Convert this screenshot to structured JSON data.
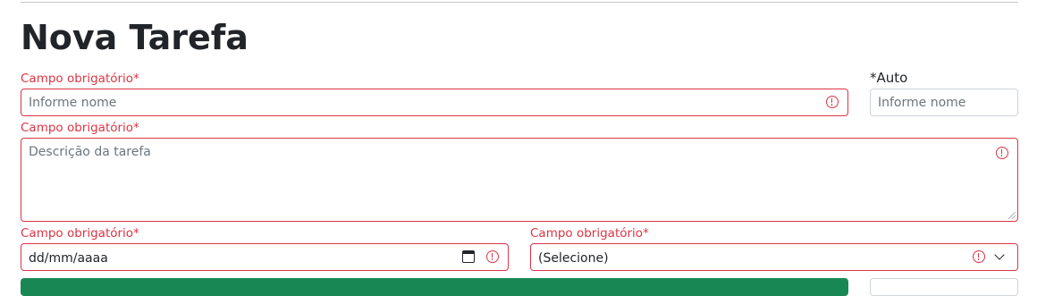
{
  "page": {
    "title": "Nova Tarefa"
  },
  "form": {
    "name": {
      "error_label": "Campo obrigatório*",
      "placeholder": "Informe nome"
    },
    "auto": {
      "label": "*Auto",
      "placeholder": "Informe nome"
    },
    "description": {
      "error_label": "Campo obrigatório*",
      "placeholder": "Descrição da tarefa"
    },
    "date": {
      "error_label": "Campo obrigatório*",
      "value": "dd/mm/aaaa"
    },
    "select": {
      "error_label": "Campo obrigatório*",
      "value": "(Selecione)"
    }
  },
  "colors": {
    "error": "#dc3545",
    "success_button": "#198754",
    "border": "#ced4da"
  },
  "icons": [
    "error-icon",
    "calendar-icon",
    "chevron-down-icon"
  ]
}
